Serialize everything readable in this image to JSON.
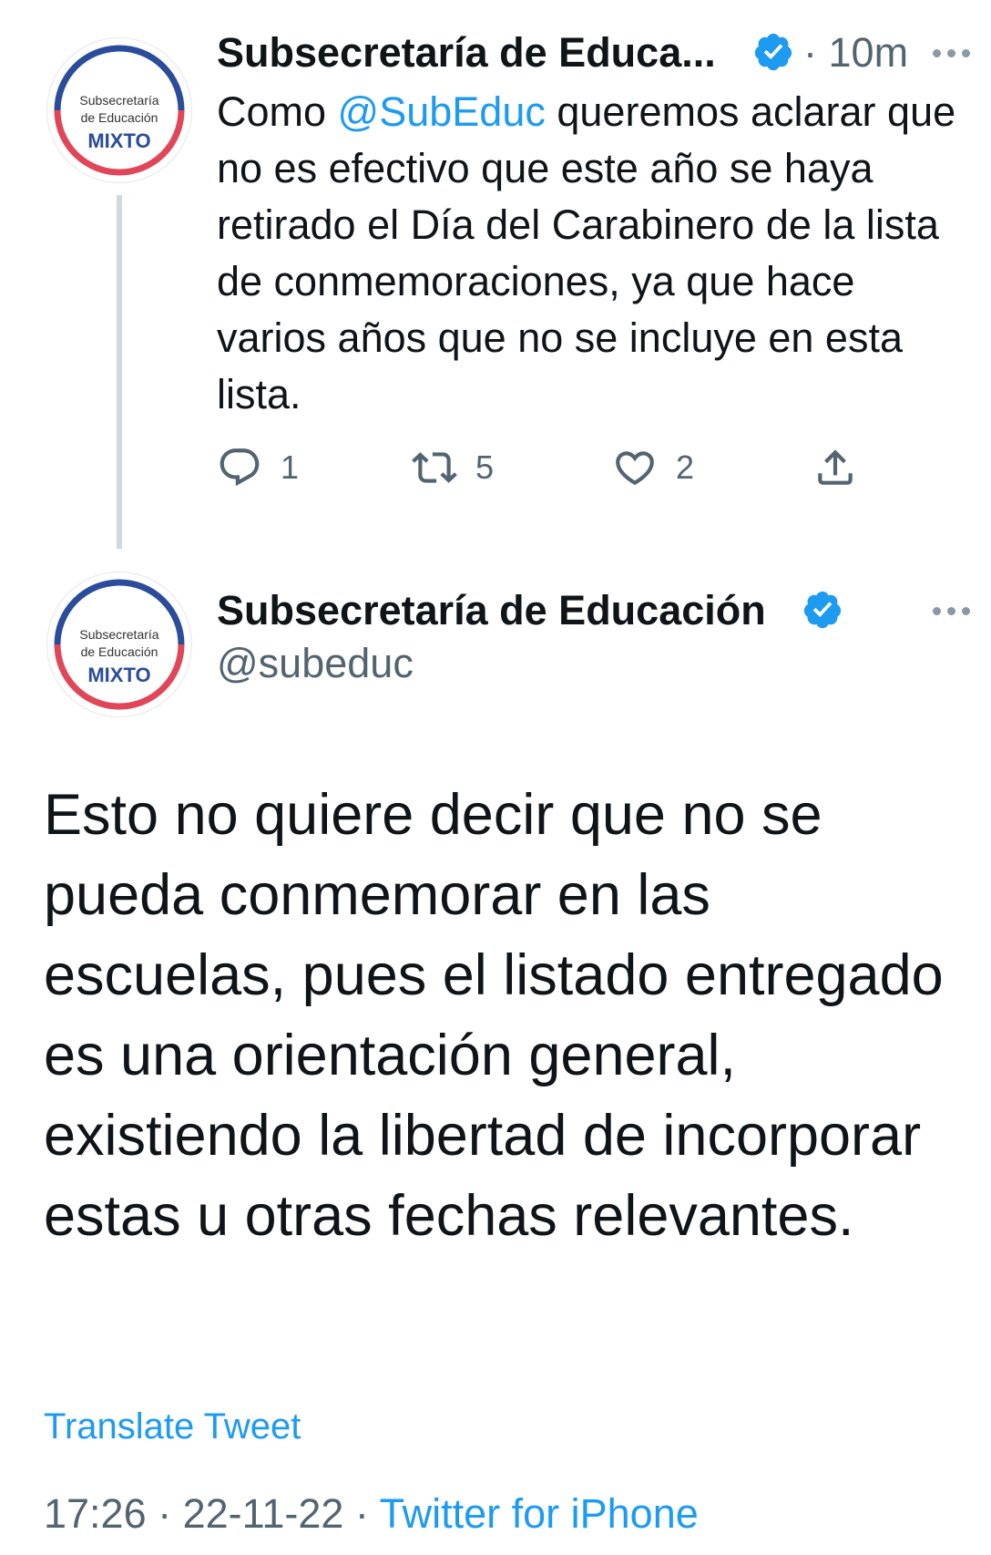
{
  "reply_tweet": {
    "avatar": {
      "line1": "Subsecretaría",
      "line2": "de Educación",
      "badge": "MIXTO"
    },
    "author_name": "Subsecretaría de Educa...",
    "separator": "·",
    "time": "10m",
    "text_parts": {
      "before": "Como ",
      "mention": "@SubEduc",
      "after": " queremos aclarar que no es efectivo que este año se haya retirado el Día del Carabinero de la lista de conmemoraciones, ya que hace varios años que no se incluye en esta lista."
    },
    "actions": {
      "reply_count": "1",
      "retweet_count": "5",
      "like_count": "2"
    }
  },
  "main_tweet": {
    "avatar": {
      "line1": "Subsecretaría",
      "line2": "de Educación",
      "badge": "MIXTO"
    },
    "author_name": "Subsecretaría de Educación",
    "handle": "@subeduc",
    "text": "Esto no quiere decir que no se pueda conmemorar en las escuelas, pues el listado entregado es una orientación general, existiendo la libertad de incorporar estas u otras fechas relevantes.",
    "translate_label": "Translate Tweet",
    "meta": {
      "time": "17:26",
      "sep1": " · ",
      "date": "22-11-22",
      "sep2": " · ",
      "source": "Twitter for iPhone"
    }
  },
  "icons": [
    "verified-icon",
    "more-icon",
    "reply-icon",
    "retweet-icon",
    "like-icon",
    "share-icon"
  ],
  "colors": {
    "link": "#1d9bf0",
    "secondary": "#536471",
    "avatar_blue": "#2b4c9b",
    "avatar_red": "#e04657",
    "thread_line": "#cfd9de"
  }
}
